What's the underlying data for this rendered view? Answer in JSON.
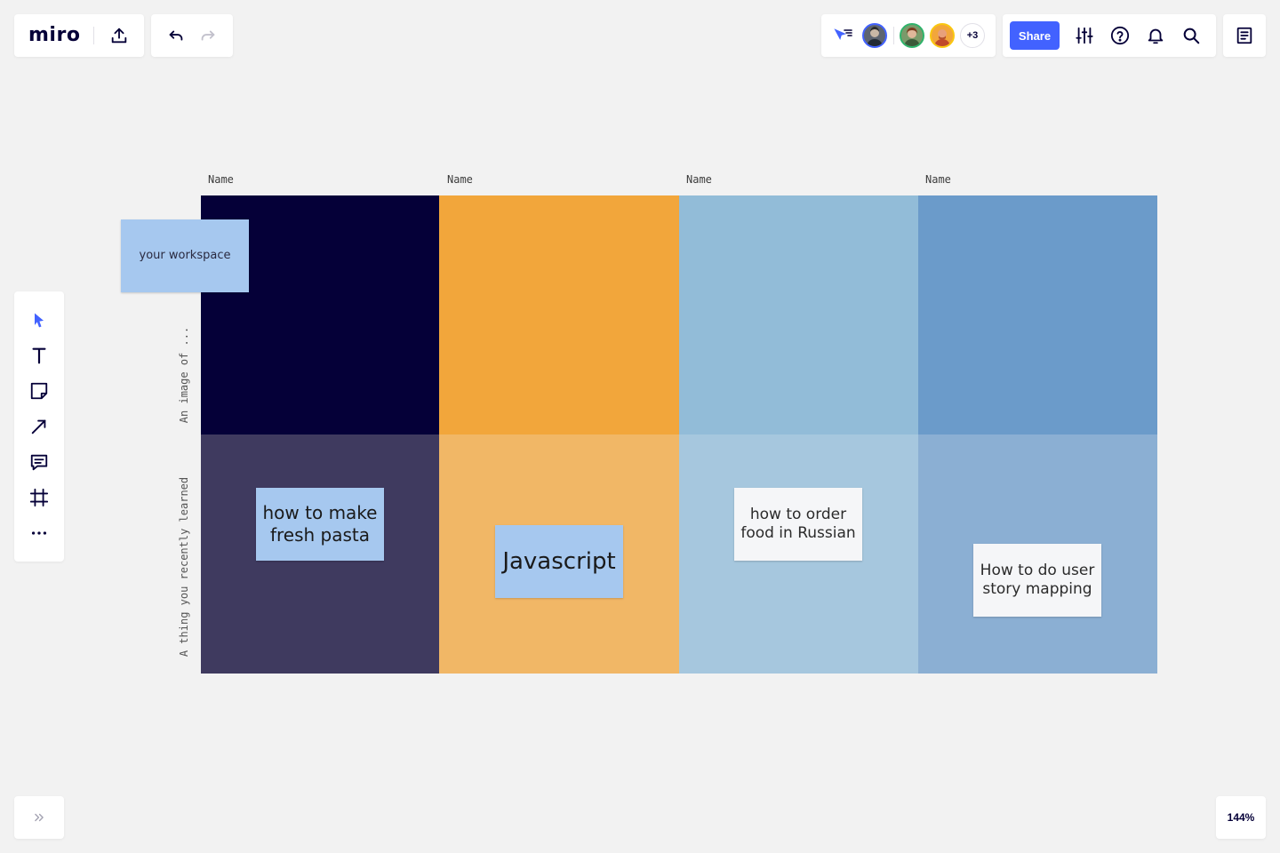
{
  "app": {
    "logo_text": "miro",
    "zoom_level": "144%"
  },
  "header": {
    "share_label": "Share",
    "more_collaborators": "+3"
  },
  "colors": {
    "accent": "#4262ff",
    "background": "#f2f2f2",
    "cell_navy": "#050038",
    "cell_orange": "#f2a63b",
    "cell_light_blue": "#92bcd8",
    "cell_mid_blue": "#6b9bca",
    "cell_navy_light": "#3f3a5f",
    "cell_orange_light": "#f1b766",
    "cell_light_blue_light": "#a6c7de",
    "cell_mid_blue_light": "#8bafd3",
    "sticky_blue": "#a6c8ef",
    "sticky_white": "#f5f6f8"
  },
  "board": {
    "columns": [
      "Name",
      "Name",
      "Name",
      "Name"
    ],
    "row_labels": [
      "An image of ...",
      "A thing you recently learned"
    ],
    "stickies": {
      "workspace": "your workspace",
      "pasta": "how to make fresh pasta",
      "javascript": "Javascript",
      "russian": "how to order food in Russian",
      "story_mapping": "How to do user story mapping"
    }
  },
  "toolbar_icons": [
    "select-icon",
    "text-icon",
    "sticky-note-icon",
    "arrow-line-icon",
    "comment-icon",
    "frame-icon",
    "more-icon"
  ]
}
